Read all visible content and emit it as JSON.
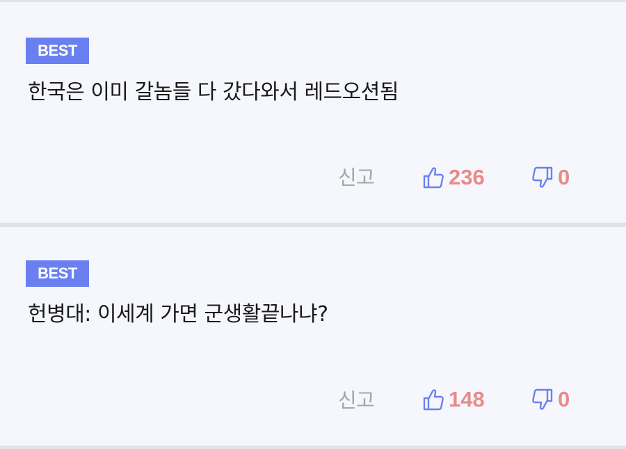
{
  "comments": [
    {
      "badge": "BEST",
      "text": "한국은 이미 갈놈들 다 갔다와서 레드오션됨",
      "report_label": "신고",
      "likes": "236",
      "dislikes": "0"
    },
    {
      "badge": "BEST",
      "text": "헌병대: 이세계 가면 군생활끝나냐?",
      "report_label": "신고",
      "likes": "148",
      "dislikes": "0"
    }
  ],
  "colors": {
    "badge_bg": "#6b80f0",
    "icon_blue": "#6b80f0",
    "count_red": "#e98a8a",
    "card_bg": "#f5f7fc",
    "separator": "#e2e3e5"
  },
  "icons": {
    "like": "thumbs-up-icon",
    "dislike": "thumbs-down-icon"
  }
}
